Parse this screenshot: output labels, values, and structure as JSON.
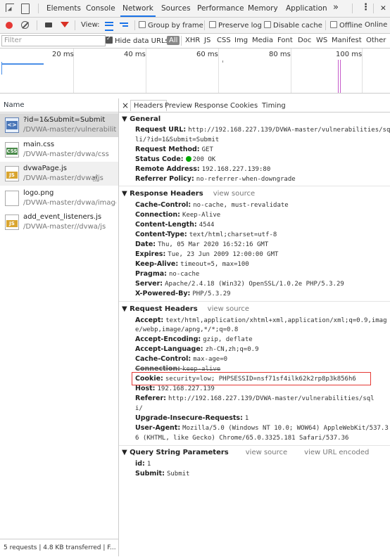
{
  "toolbar": {
    "tabs": [
      "Elements",
      "Console",
      "Network",
      "Sources",
      "Performance",
      "Memory",
      "Application"
    ],
    "active": "Network",
    "more": "»",
    "kebab": "⋮",
    "close": "✕"
  },
  "bar2": {
    "view_label": "View:",
    "group_by_frame": "Group by frame",
    "preserve_log": "Preserve log",
    "disable_cache": "Disable cache",
    "offline": "Offline",
    "online": "Online"
  },
  "filter": {
    "placeholder": "Filter",
    "hide_data_urls": "Hide data URLs",
    "types": [
      "All",
      "XHR",
      "JS",
      "CSS",
      "Img",
      "Media",
      "Font",
      "Doc",
      "WS",
      "Manifest",
      "Other"
    ]
  },
  "timeline": {
    "ticks": [
      "20 ms",
      "40 ms",
      "60 ms",
      "80 ms",
      "100 ms"
    ]
  },
  "requests": {
    "header": "Name",
    "items": [
      {
        "name": "?id=1&Submit=Submit",
        "path": "/DVWA-master/vulnerabiliti...",
        "type": "doc"
      },
      {
        "name": "main.css",
        "path": "/DVWA-master/dvwa/css",
        "type": "css"
      },
      {
        "name": "dvwaPage.js",
        "path": "/DVWA-master/dvwa/js",
        "type": "js"
      },
      {
        "name": "logo.png",
        "path": "/DVWA-master/dvwa/images",
        "type": "img"
      },
      {
        "name": "add_event_listeners.js",
        "path": "/DVWA-master//dvwa/js",
        "type": "js"
      }
    ],
    "status": "5 requests | 4.8 KB transferred | F..."
  },
  "detail": {
    "close": "×",
    "tabs": [
      "Headers",
      "Preview",
      "Response",
      "Cookies",
      "Timing"
    ],
    "active_tab": "Headers",
    "view_source": "view source",
    "view_url_encoded": "view URL encoded",
    "general": {
      "title": "General",
      "request_url_label": "Request URL:",
      "request_url_1": "http://192.168.227.139/DVWA-master/vulnerabilities/sq",
      "request_url_2": "li/?id=1&Submit=Submit",
      "method_label": "Request Method:",
      "method": "GET",
      "status_label": "Status Code:",
      "status": "200 OK",
      "remote_label": "Remote Address:",
      "remote": "192.168.227.139:80",
      "referrer_label": "Referrer Policy:",
      "referrer": "no-referrer-when-downgrade"
    },
    "response_headers": {
      "title": "Response Headers",
      "rows": [
        {
          "k": "Cache-Control:",
          "v": "no-cache, must-revalidate"
        },
        {
          "k": "Connection:",
          "v": "Keep-Alive"
        },
        {
          "k": "Content-Length:",
          "v": "4544"
        },
        {
          "k": "Content-Type:",
          "v": "text/html;charset=utf-8"
        },
        {
          "k": "Date:",
          "v": "Thu, 05 Mar 2020 16:52:16 GMT"
        },
        {
          "k": "Expires:",
          "v": "Tue, 23 Jun 2009 12:00:00 GMT"
        },
        {
          "k": "Keep-Alive:",
          "v": "timeout=5, max=100"
        },
        {
          "k": "Pragma:",
          "v": "no-cache"
        },
        {
          "k": "Server:",
          "v": "Apache/2.4.18 (Win32) OpenSSL/1.0.2e PHP/5.3.29"
        },
        {
          "k": "X-Powered-By:",
          "v": "PHP/5.3.29"
        }
      ]
    },
    "request_headers": {
      "title": "Request Headers",
      "accept_k": "Accept:",
      "accept_1": "text/html,application/xhtml+xml,application/xml;q=0.9,imag",
      "accept_2": "e/webp,image/apng,*/*;q=0.8",
      "encoding_k": "Accept-Encoding:",
      "encoding": "gzip, deflate",
      "language_k": "Accept-Language:",
      "language": "zh-CN,zh;q=0.9",
      "cache_k": "Cache-Control:",
      "cache": "max-age=0",
      "connection_k": "Connection:",
      "connection": "keep-alive",
      "cookie_k": "Cookie:",
      "cookie": "security=low; PHPSESSID=nsf71sf4ilk62k2rp8p3k856h6",
      "host_k": "Host:",
      "host": "192.168.227.139",
      "referer_k": "Referer:",
      "referer_1": "http://192.168.227.139/DVWA-master/vulnerabilities/sql",
      "referer_2": "i/",
      "upgrade_k": "Upgrade-Insecure-Requests:",
      "upgrade": "1",
      "ua_k": "User-Agent:",
      "ua_1": "Mozilla/5.0 (Windows NT 10.0; WOW64) AppleWebKit/537.3",
      "ua_2": "6 (KHTML, like Gecko) Chrome/65.0.3325.181 Safari/537.36"
    },
    "query": {
      "title": "Query String Parameters",
      "id_k": "id:",
      "id": "1",
      "submit_k": "Submit:",
      "submit": "Submit"
    }
  },
  "colors": {
    "accent": "#1a73e8",
    "highlight_box": "#e53935",
    "record": "#e53935"
  }
}
